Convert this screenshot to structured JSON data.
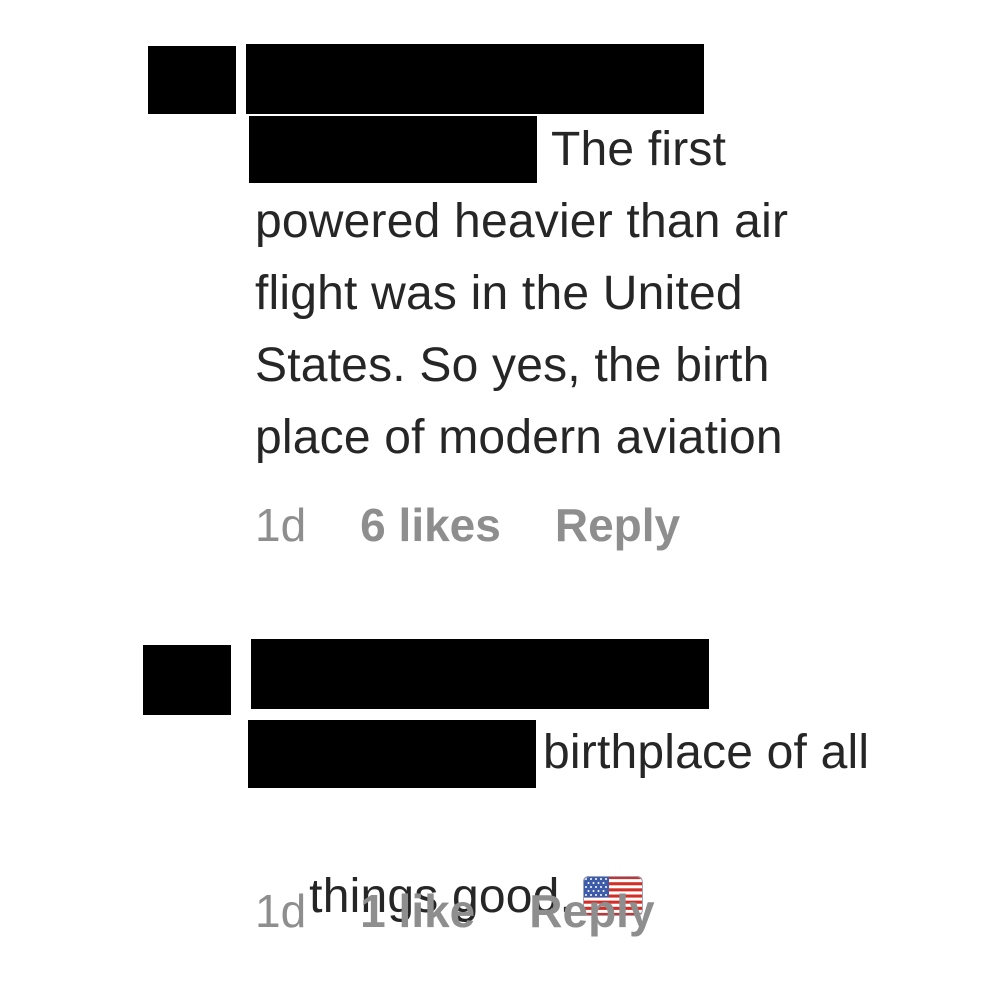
{
  "comments": [
    {
      "text_first_line": "The first",
      "text_rest": "powered heavier than air\nflight was in the United\nStates. So yes, the birth\nplace of modern aviation",
      "time": "1d",
      "likes": "6 likes",
      "reply": "Reply"
    },
    {
      "text_first_line": "birthplace of all",
      "text_rest": "things good.",
      "emoji": "us-flag-icon",
      "time": "1d",
      "likes": "1 like",
      "reply": "Reply"
    }
  ],
  "colors": {
    "text": "#262626",
    "meta": "#8e8e8e",
    "redaction": "#000000",
    "background": "#ffffff"
  }
}
